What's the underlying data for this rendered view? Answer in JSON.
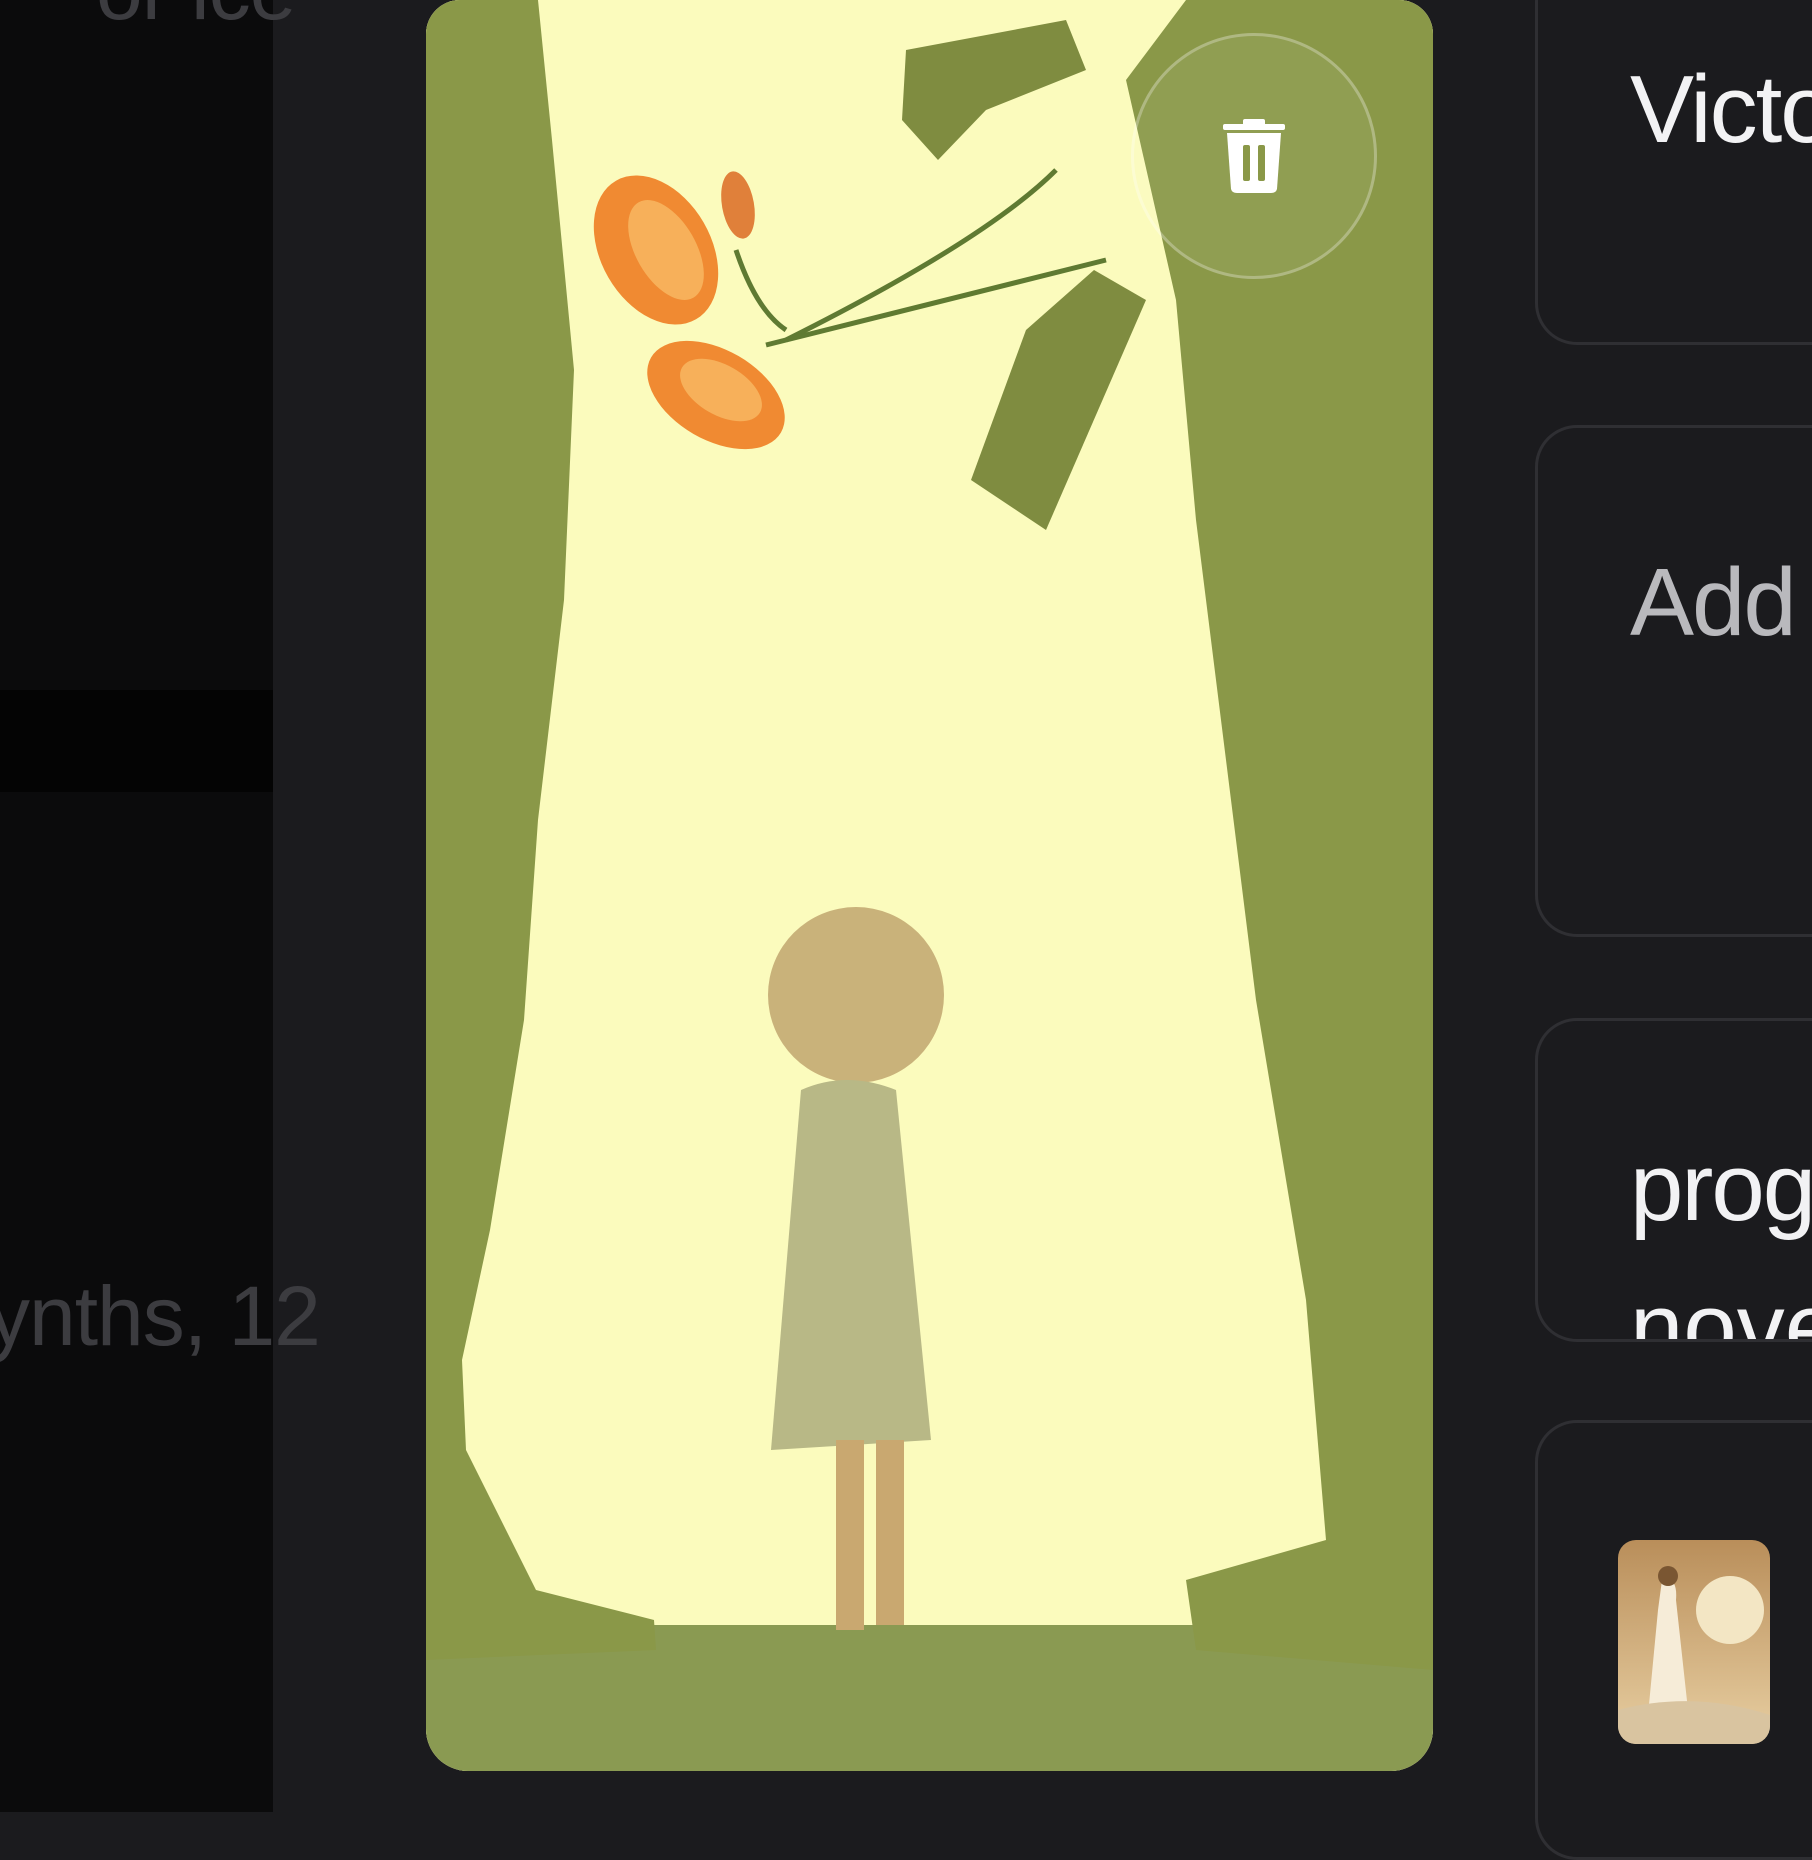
{
  "background": {
    "left_text_top": "or ice",
    "left_text_bottom": "ynths, 12"
  },
  "image_card": {
    "delete_icon": "trash-icon",
    "colors": {
      "sky": "#fbfbbd",
      "silhouette": "#8a9848",
      "flower": "#f08a32"
    }
  },
  "right_panels": {
    "panel1_text": "Victo",
    "panel2_text": "Add",
    "panel3_text": "prog",
    "panel3_text_line2": "nove"
  }
}
